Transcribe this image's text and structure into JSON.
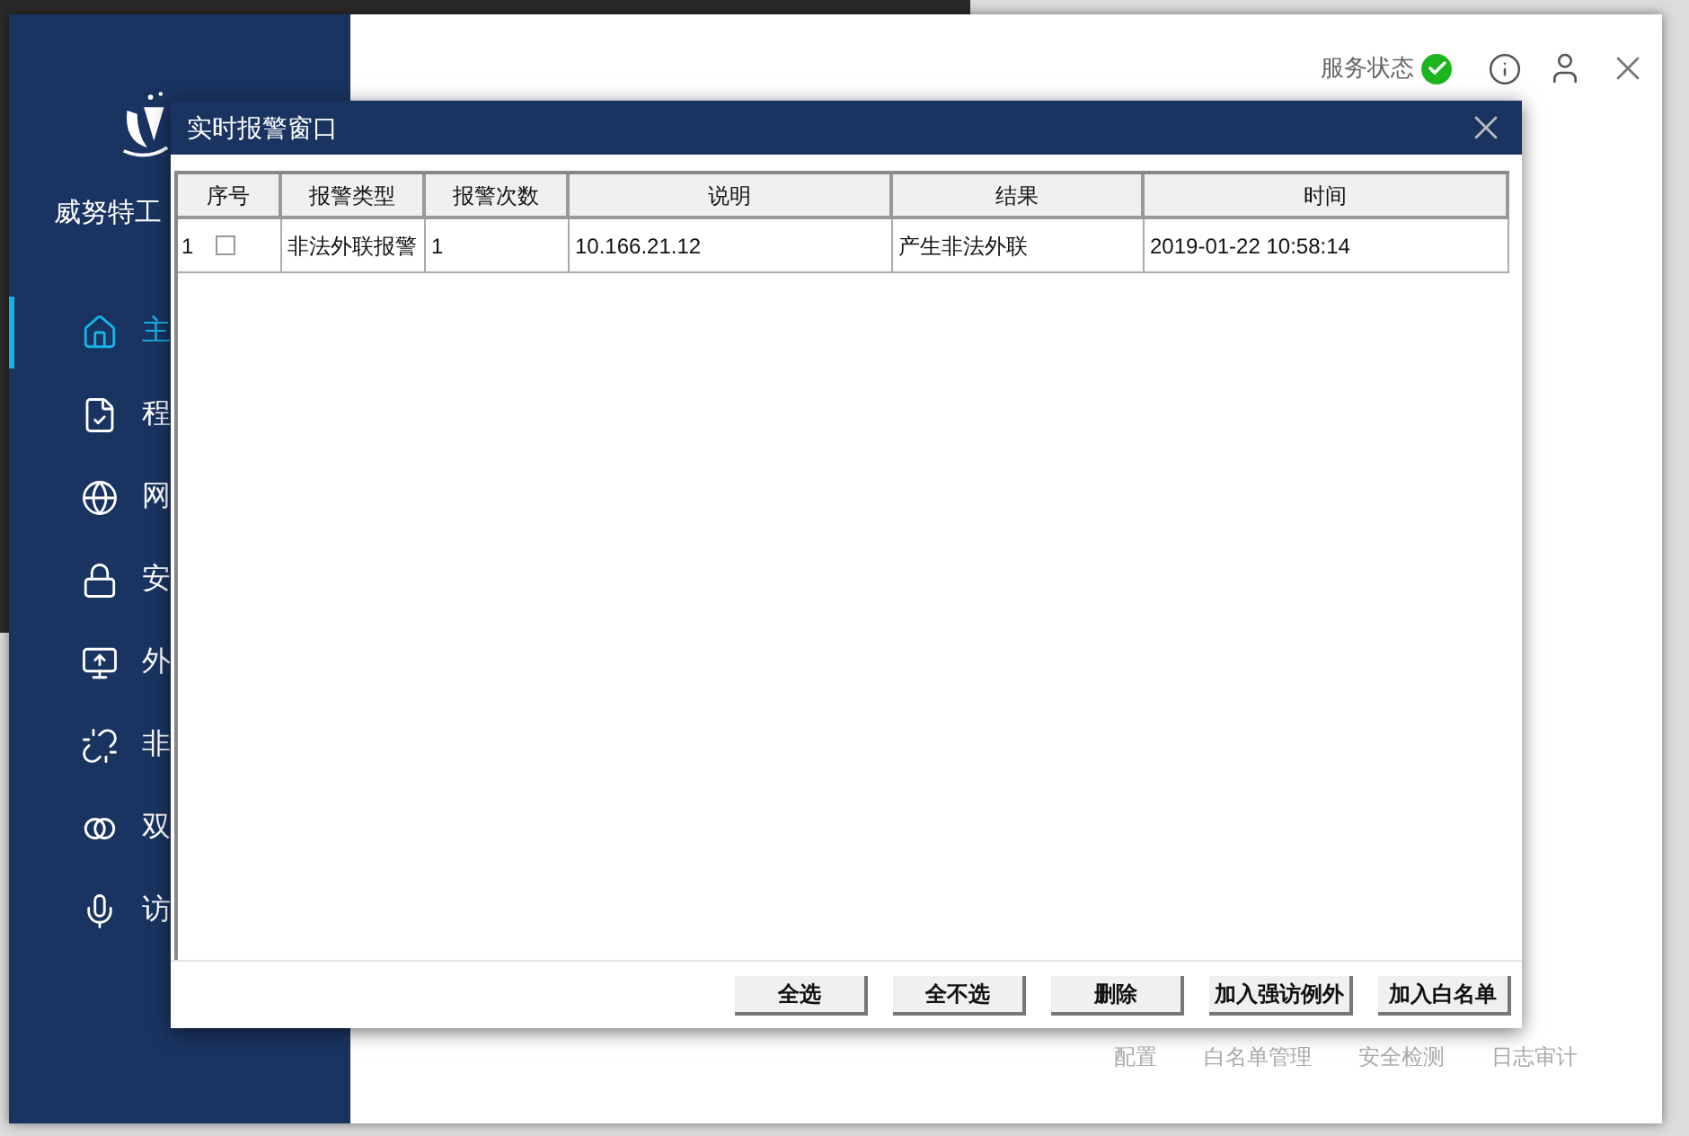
{
  "sidebar": {
    "brand": "威努特工",
    "items": [
      {
        "label": "主",
        "selected": true
      },
      {
        "label": "程",
        "selected": false
      },
      {
        "label": "网",
        "selected": false
      },
      {
        "label": "安",
        "selected": false
      },
      {
        "label": "外",
        "selected": false
      },
      {
        "label": "非",
        "selected": false
      },
      {
        "label": "双",
        "selected": false
      },
      {
        "label": "访",
        "selected": false
      }
    ]
  },
  "header": {
    "service_status": "服务状态",
    "service_ok": true
  },
  "bottom_tabs": [
    "配置",
    "白名单管理",
    "安全检测",
    "日志审计"
  ],
  "dialog": {
    "title": "实时报警窗口",
    "table": {
      "columns": [
        "序号",
        "报警类型",
        "报警次数",
        "说明",
        "结果",
        "时间"
      ],
      "rows": [
        {
          "index": "1",
          "checked": false,
          "type": "非法外联报警",
          "count": "1",
          "description": "10.166.21.12",
          "result": "产生非法外联",
          "time": "2019-01-22 10:58:14"
        }
      ]
    },
    "buttons": [
      "全选",
      "全不选",
      "删除",
      "加入强访例外",
      "加入白名单"
    ]
  }
}
